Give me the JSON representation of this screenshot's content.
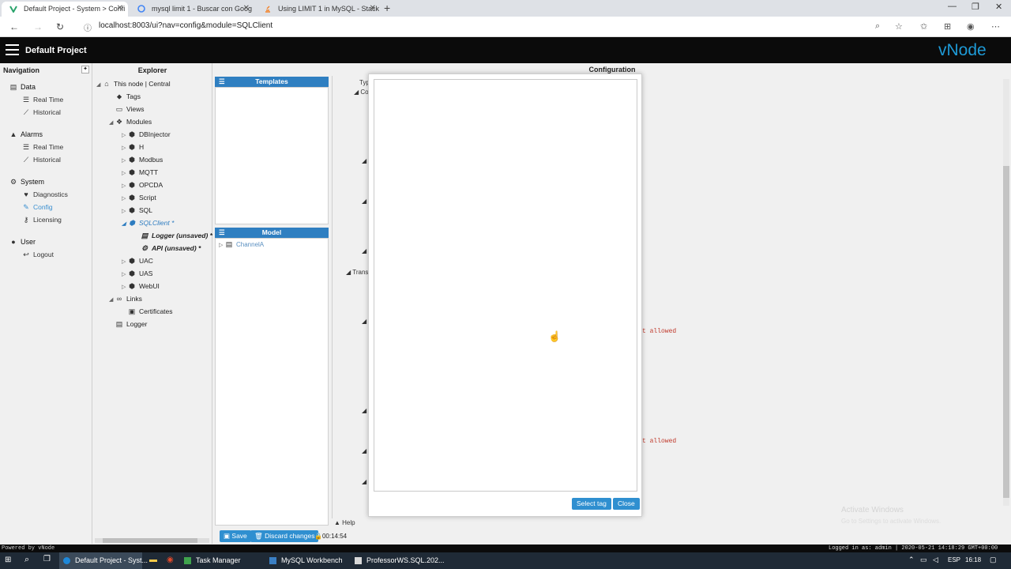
{
  "browser": {
    "tabs": [
      {
        "title": "Default Project - System > Confi",
        "active": true
      },
      {
        "title": "mysql limit 1 - Buscar con Goog",
        "active": false
      },
      {
        "title": "Using LIMIT 1 in MySQL - Stack",
        "active": false
      }
    ],
    "url": "localhost:8003/ui?nav=config&module=SQLClient"
  },
  "app": {
    "project_title": "Default Project",
    "logo": "vNode",
    "accent_color": "#2f7fc1"
  },
  "navigation": {
    "title": "Navigation",
    "groups": [
      {
        "label": "Data",
        "items": [
          "Real Time",
          "Historical"
        ]
      },
      {
        "label": "Alarms",
        "items": [
          "Real Time",
          "Historical"
        ]
      },
      {
        "label": "System",
        "items": [
          "Diagnostics",
          "Config",
          "Licensing"
        ]
      },
      {
        "label": "User",
        "items": [
          "Logout"
        ]
      }
    ]
  },
  "explorer": {
    "title": "Explorer",
    "nodes": [
      "This node | Central",
      "Tags",
      "Views",
      "Modules",
      "DBInjector",
      "H",
      "Modbus",
      "MQTT",
      "OPCDA",
      "Script",
      "SQL",
      "SQLClient *",
      "Logger (unsaved) *",
      "API (unsaved) *",
      "UAC",
      "UAS",
      "WebUI",
      "Links",
      "Certificates",
      "Logger"
    ]
  },
  "templates": {
    "title": "Templates"
  },
  "model": {
    "title": "Model",
    "items": [
      "ChannelA"
    ]
  },
  "configuration": {
    "title": "Configuration",
    "labels": [
      "Typ",
      "Co",
      "Transa"
    ],
    "error_text": "t allowed",
    "help": "Help"
  },
  "modal": {
    "select_label": "Select tag",
    "close_label": "Close"
  },
  "bottom": {
    "save": "Save",
    "discard": "Discard changes",
    "timer": "00:14:54",
    "powered": "Powered by vNode",
    "status_right": "Logged in as: admin | 2020-05-21 14:18:29 GMT+00:00"
  },
  "watermark": {
    "line1": "Activate Windows",
    "line2": "Go to Settings to activate Windows."
  },
  "taskbar": {
    "apps": [
      "Default Project - Syst...",
      "Task Manager",
      "MySQL Workbench",
      "ProfessorWS.SQL.202..."
    ],
    "lang": "ESP",
    "clock": "16:18"
  }
}
